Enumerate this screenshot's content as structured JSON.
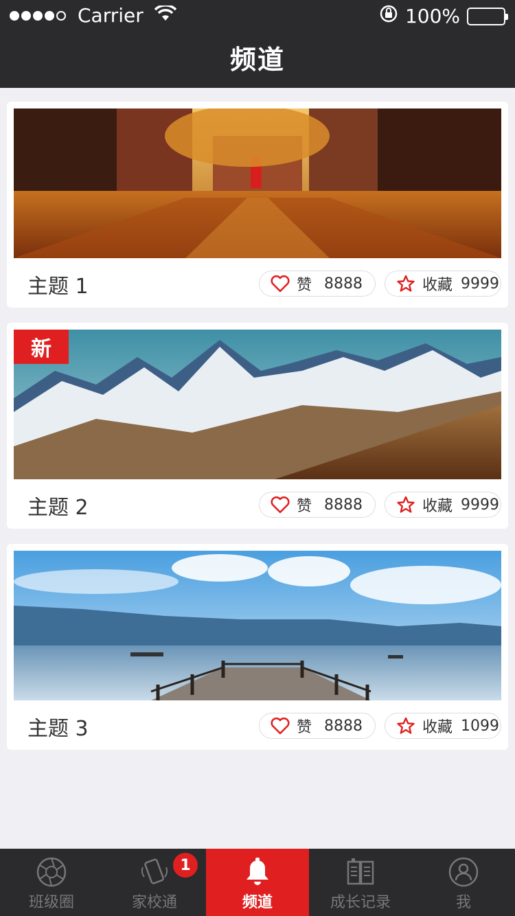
{
  "status_bar": {
    "carrier": "Carrier",
    "battery": "100%"
  },
  "header": {
    "title": "频道"
  },
  "cards": [
    {
      "topic": "主题 1",
      "like_label": "赞",
      "like_count": "8888",
      "fav_label": "收藏",
      "fav_count": "9999",
      "image": "autumn-street-photo"
    },
    {
      "topic": "主题 2",
      "like_label": "赞",
      "like_count": "8888",
      "fav_label": "收藏",
      "fav_count": "9999",
      "image": "snowy-mountains-photo",
      "badge": "新"
    },
    {
      "topic": "主题 3",
      "like_label": "赞",
      "like_count": "8888",
      "fav_label": "收藏",
      "fav_count": "1099",
      "image": "lake-pier-photo"
    }
  ],
  "tabbar": {
    "items": [
      {
        "label": "班级圈",
        "icon": "aperture-icon"
      },
      {
        "label": "家校通",
        "icon": "phone-ring-icon",
        "badge": "1"
      },
      {
        "label": "频道",
        "icon": "bell-icon",
        "active": true
      },
      {
        "label": "成长记录",
        "icon": "book-icon"
      },
      {
        "label": "我",
        "icon": "user-icon"
      }
    ]
  },
  "colors": {
    "accent": "#e02020",
    "header_bg": "#2b2b2e",
    "page_bg": "#efeff4"
  }
}
